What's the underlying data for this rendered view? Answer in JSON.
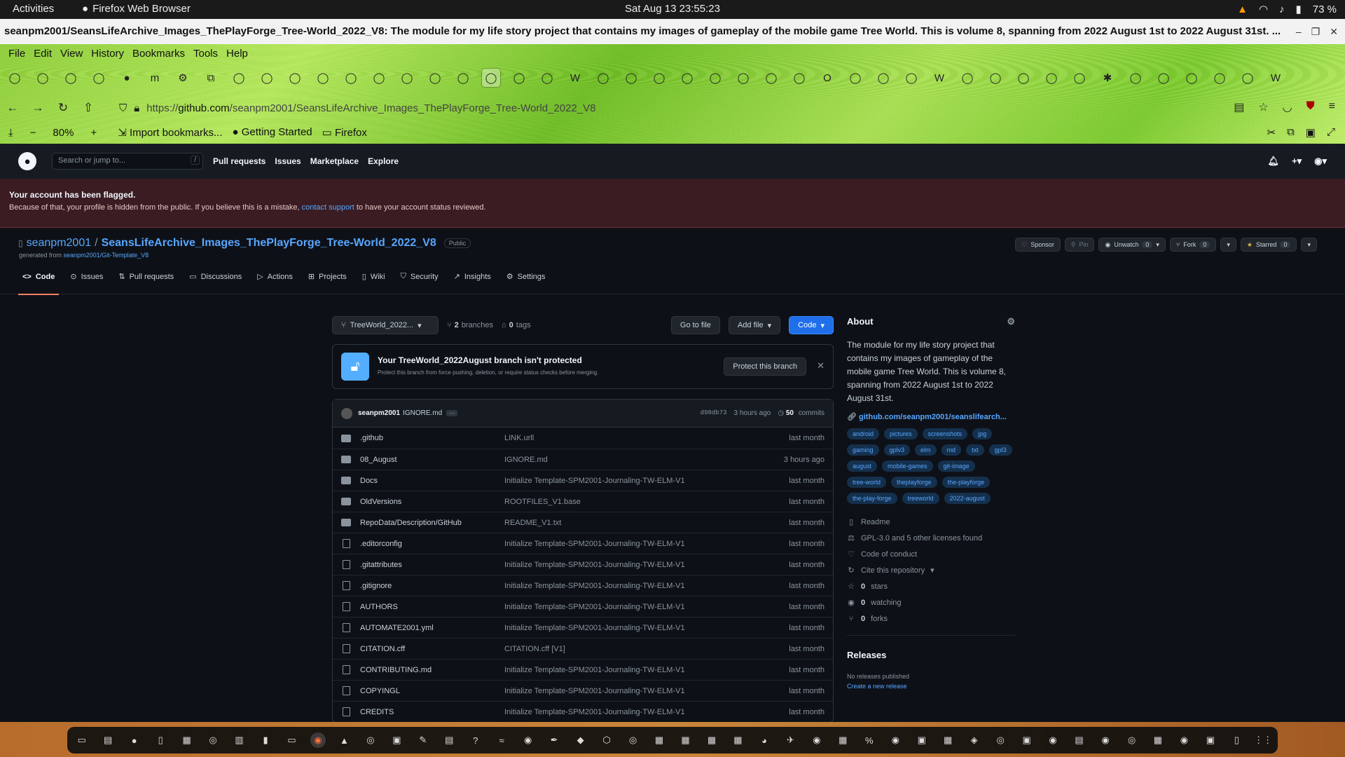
{
  "system": {
    "activities": "Activities",
    "app": "Firefox Web Browser",
    "clock": "Sat Aug 13  23:55:23",
    "battery": "73 %"
  },
  "window": {
    "title": "seanpm2001/SeansLifeArchive_Images_ThePlayForge_Tree-World_2022_V8: The module for my life story project that contains my images of gameplay of the mobile game Tree World. This is volume 8, spanning from 2022 August 1st to 2022 August 31st. ..."
  },
  "menu": [
    "File",
    "Edit",
    "View",
    "History",
    "Bookmarks",
    "Tools",
    "Help"
  ],
  "url": {
    "scheme": "https://",
    "host": "github.com",
    "path": "/seanpm2001/SeansLifeArchive_Images_ThePlayForge_Tree-World_2022_V8"
  },
  "bookmarks": {
    "zoom": "80%",
    "items": [
      "Import bookmarks...",
      "Getting Started",
      "Firefox"
    ]
  },
  "gh": {
    "search": "Search or jump to...",
    "search_key": "/",
    "nav": [
      "Pull requests",
      "Issues",
      "Marketplace",
      "Explore"
    ],
    "flag_title": "Your account has been flagged.",
    "flag_text1": "Because of that, your profile is hidden from the public. If you believe this is a mistake, ",
    "flag_link": "contact support",
    "flag_text2": " to have your account status reviewed.",
    "owner": "seanpm2001",
    "sep": "/",
    "repo": "SeansLifeArchive_Images_ThePlayForge_Tree-World_2022_V8",
    "visibility": "Public",
    "generated_prefix": "generated from ",
    "generated_link": "seanpm2001/Git-Template_V8",
    "buttons": {
      "sponsor": "Sponsor",
      "pin": "Pin",
      "unwatch": "Unwatch",
      "watch_count": "0",
      "fork": "Fork",
      "fork_count": "0",
      "starred": "Starred",
      "star_count": "0"
    },
    "tabs": [
      "Code",
      "Issues",
      "Pull requests",
      "Discussions",
      "Actions",
      "Projects",
      "Wiki",
      "Security",
      "Insights",
      "Settings"
    ],
    "branch": "TreeWorld_2022...",
    "branches_count": "2",
    "branches_label": "branches",
    "tags_count": "0",
    "tags_label": "tags",
    "goto": "Go to file",
    "addfile": "Add file",
    "code": "Code",
    "protect_title": "Your TreeWorld_2022August branch isn't protected",
    "protect_sub": "Protect this branch from force pushing, deletion, or require status checks before merging.",
    "protect_btn": "Protect this branch",
    "commit": {
      "author": "seanpm2001",
      "msg": "IGNORE.md",
      "hash": "d98db73",
      "when": "3 hours ago",
      "count": "50",
      "count_label": "commits"
    },
    "files": [
      {
        "name": ".github",
        "msg": "LINK.urll",
        "age": "last month",
        "dir": true
      },
      {
        "name": "08_August",
        "msg": "IGNORE.md",
        "age": "3 hours ago",
        "dir": true
      },
      {
        "name": "Docs",
        "msg": "Initialize Template-SPM2001-Journaling-TW-ELM-V1",
        "age": "last month",
        "dir": true
      },
      {
        "name": "OldVersions",
        "msg": "ROOTFILES_V1.base",
        "age": "last month",
        "dir": true
      },
      {
        "name": "RepoData/Description/GitHub",
        "msg": "README_V1.txt",
        "age": "last month",
        "dir": true
      },
      {
        "name": ".editorconfig",
        "msg": "Initialize Template-SPM2001-Journaling-TW-ELM-V1",
        "age": "last month",
        "dir": false
      },
      {
        "name": ".gitattributes",
        "msg": "Initialize Template-SPM2001-Journaling-TW-ELM-V1",
        "age": "last month",
        "dir": false
      },
      {
        "name": ".gitignore",
        "msg": "Initialize Template-SPM2001-Journaling-TW-ELM-V1",
        "age": "last month",
        "dir": false
      },
      {
        "name": "AUTHORS",
        "msg": "Initialize Template-SPM2001-Journaling-TW-ELM-V1",
        "age": "last month",
        "dir": false
      },
      {
        "name": "AUTOMATE2001.yml",
        "msg": "Initialize Template-SPM2001-Journaling-TW-ELM-V1",
        "age": "last month",
        "dir": false
      },
      {
        "name": "CITATION.cff",
        "msg": "CITATION.cff [V1]",
        "age": "last month",
        "dir": false
      },
      {
        "name": "CONTRIBUTING.md",
        "msg": "Initialize Template-SPM2001-Journaling-TW-ELM-V1",
        "age": "last month",
        "dir": false
      },
      {
        "name": "COPYINGL",
        "msg": "Initialize Template-SPM2001-Journaling-TW-ELM-V1",
        "age": "last month",
        "dir": false
      },
      {
        "name": "CREDITS",
        "msg": "Initialize Template-SPM2001-Journaling-TW-ELM-V1",
        "age": "last month",
        "dir": false
      }
    ],
    "about": {
      "title": "About",
      "desc": "The module for my life story project that contains my images of gameplay of the mobile game Tree World. This is volume 8, spanning from 2022 August 1st to 2022 August 31st.",
      "link": "github.com/seanpm2001/seanslifearch...",
      "topics": [
        "android",
        "pictures",
        "screenshots",
        "jpg",
        "gaming",
        "gplv3",
        "elm",
        "md",
        "txt",
        "gpl3",
        "august",
        "mobile-games",
        "git-image",
        "tree-world",
        "theplayforge",
        "the-playforge",
        "the-play-forge",
        "treeworld",
        "2022-august"
      ],
      "readme": "Readme",
      "license": "GPL-3.0 and 5 other licenses found",
      "coc": "Code of conduct",
      "cite": "Cite this repository",
      "stars_n": "0",
      "stars": "stars",
      "watch_n": "0",
      "watch": "watching",
      "forks_n": "0",
      "forks": "forks"
    },
    "releases": {
      "title": "Releases",
      "none": "No releases published",
      "create": "Create a new release"
    }
  },
  "colors": {
    "accent": "#1f6feb",
    "link": "#58a6ff",
    "flag_bg": "#3a1c22"
  }
}
